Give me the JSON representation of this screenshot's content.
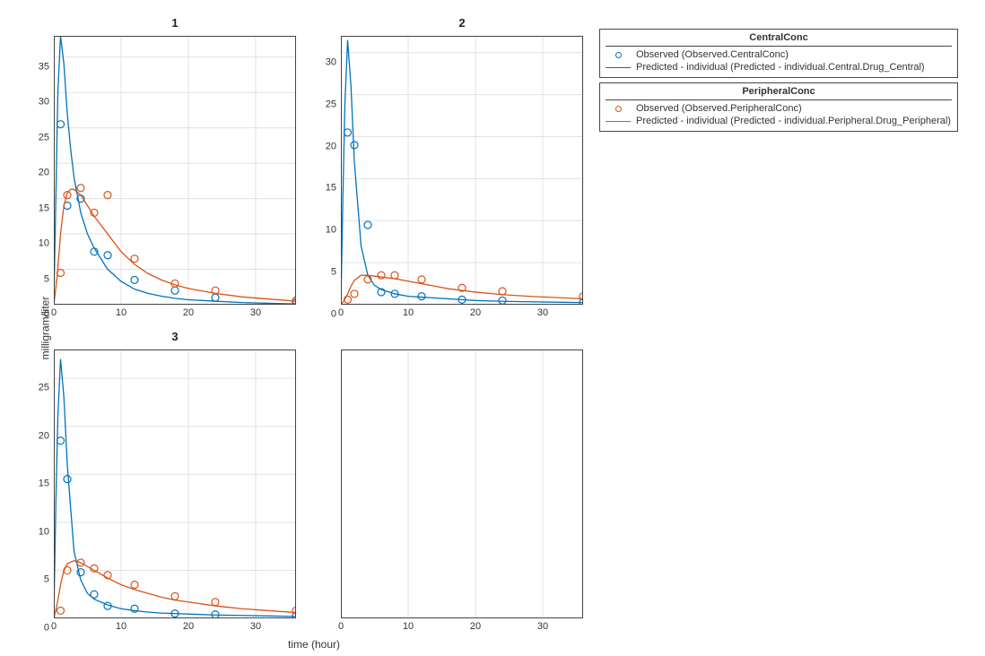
{
  "xlabel": "time (hour)",
  "ylabel": "milligram/liter",
  "colors": {
    "central": "#0072BD",
    "peripheral": "#D95319",
    "grid": "#e0e0e0",
    "axis": "#444"
  },
  "legends": {
    "central": {
      "title": "CentralConc",
      "items": [
        {
          "kind": "circle",
          "color": "central",
          "label": "Observed (Observed.CentralConc)"
        },
        {
          "kind": "line",
          "color": "central",
          "label": "Predicted - individual (Predicted - individual.Central.Drug_Central)"
        }
      ]
    },
    "peripheral": {
      "title": "PeripheralConc",
      "items": [
        {
          "kind": "circle",
          "color": "peripheral",
          "label": "Observed (Observed.PeripheralConc)"
        },
        {
          "kind": "line",
          "color": "peripheral",
          "label": "Predicted - individual (Predicted - individual.Peripheral.Drug_Peripheral)"
        }
      ]
    }
  },
  "chart_data": [
    {
      "id": "1",
      "title": "1",
      "xlim": [
        0,
        36
      ],
      "ylim": [
        0,
        38
      ],
      "xticks": [
        0,
        10,
        20,
        30
      ],
      "yticks": [
        0,
        5,
        10,
        15,
        20,
        25,
        30,
        35
      ],
      "series": [
        {
          "name": "Observed CentralConc",
          "kind": "points",
          "color": "central",
          "x": [
            1,
            2,
            4,
            6,
            8,
            12,
            18,
            24,
            36
          ],
          "y": [
            25.5,
            14.0,
            15.0,
            7.5,
            7.0,
            3.5,
            2.0,
            1.0,
            0.3
          ]
        },
        {
          "name": "Predicted CentralConc",
          "kind": "line",
          "color": "central",
          "x": [
            0,
            0.3,
            0.6,
            1,
            1.5,
            2,
            2.5,
            3,
            4,
            5,
            6,
            8,
            10,
            12,
            14,
            16,
            18,
            20,
            24,
            28,
            32,
            36
          ],
          "y": [
            0,
            15,
            30,
            38,
            34,
            27,
            22,
            18,
            13,
            10,
            8,
            5,
            3.3,
            2.2,
            1.6,
            1.2,
            0.9,
            0.7,
            0.5,
            0.3,
            0.2,
            0.1
          ]
        },
        {
          "name": "Observed PeripheralConc",
          "kind": "points",
          "color": "peripheral",
          "x": [
            1,
            2,
            4,
            6,
            8,
            12,
            18,
            24,
            36
          ],
          "y": [
            4.5,
            15.5,
            16.5,
            13.0,
            15.5,
            6.5,
            3.0,
            2.0,
            0.6
          ]
        },
        {
          "name": "Predicted PeripheralConc",
          "kind": "line",
          "color": "peripheral",
          "x": [
            0,
            0.5,
            1,
            1.5,
            2,
            2.5,
            3,
            4,
            5,
            6,
            8,
            10,
            12,
            14,
            16,
            18,
            20,
            24,
            28,
            32,
            36
          ],
          "y": [
            0,
            4,
            10,
            14,
            15.8,
            16.3,
            16.3,
            15.5,
            14,
            12.5,
            10,
            7.5,
            5.7,
            4.4,
            3.5,
            2.8,
            2.3,
            1.6,
            1.1,
            0.8,
            0.5
          ]
        }
      ]
    },
    {
      "id": "2",
      "title": "2",
      "xlim": [
        0,
        36
      ],
      "ylim": [
        0,
        32
      ],
      "xticks": [
        0,
        10,
        20,
        30
      ],
      "yticks": [
        0,
        5,
        10,
        15,
        20,
        25,
        30
      ],
      "series": [
        {
          "name": "Observed CentralConc",
          "kind": "points",
          "color": "central",
          "x": [
            1,
            2,
            4,
            6,
            8,
            12,
            18,
            24,
            36
          ],
          "y": [
            20.5,
            19.0,
            9.5,
            1.5,
            1.3,
            1.0,
            0.6,
            0.5,
            0.3
          ]
        },
        {
          "name": "Predicted CentralConc",
          "kind": "line",
          "color": "central",
          "x": [
            0,
            0.3,
            0.6,
            1,
            1.5,
            2,
            3,
            4,
            5,
            6,
            8,
            10,
            12,
            14,
            16,
            18,
            20,
            24,
            28,
            32,
            36
          ],
          "y": [
            0,
            13,
            24,
            31.5,
            26,
            17,
            7,
            3.5,
            2.3,
            1.8,
            1.3,
            1.0,
            0.9,
            0.8,
            0.7,
            0.6,
            0.5,
            0.4,
            0.35,
            0.3,
            0.25
          ]
        },
        {
          "name": "Observed PeripheralConc",
          "kind": "points",
          "color": "peripheral",
          "x": [
            1,
            2,
            4,
            6,
            8,
            12,
            18,
            24,
            36
          ],
          "y": [
            0.6,
            1.3,
            3.0,
            3.5,
            3.5,
            3.0,
            2.0,
            1.6,
            1.0
          ]
        },
        {
          "name": "Predicted PeripheralConc",
          "kind": "line",
          "color": "peripheral",
          "x": [
            0,
            0.5,
            1,
            1.5,
            2,
            3,
            4,
            6,
            8,
            10,
            12,
            14,
            16,
            18,
            20,
            24,
            28,
            32,
            36
          ],
          "y": [
            0,
            0.5,
            1.3,
            2.2,
            2.9,
            3.5,
            3.5,
            3.3,
            3.1,
            2.8,
            2.5,
            2.2,
            1.9,
            1.7,
            1.5,
            1.2,
            1.0,
            0.85,
            0.7
          ]
        }
      ]
    },
    {
      "id": "3",
      "title": "3",
      "xlim": [
        0,
        36
      ],
      "ylim": [
        0,
        28
      ],
      "xticks": [
        0,
        10,
        20,
        30
      ],
      "yticks": [
        0,
        5,
        10,
        15,
        20,
        25
      ],
      "series": [
        {
          "name": "Observed CentralConc",
          "kind": "points",
          "color": "central",
          "x": [
            1,
            2,
            4,
            6,
            8,
            12,
            18,
            24,
            36
          ],
          "y": [
            18.5,
            14.5,
            4.8,
            2.5,
            1.3,
            1.0,
            0.5,
            0.4,
            0.3
          ]
        },
        {
          "name": "Predicted CentralConc",
          "kind": "line",
          "color": "central",
          "x": [
            0,
            0.3,
            0.6,
            1,
            1.5,
            2,
            3,
            4,
            5,
            6,
            8,
            10,
            12,
            14,
            16,
            18,
            20,
            24,
            28,
            32,
            36
          ],
          "y": [
            0,
            12,
            21,
            27,
            23,
            16,
            7,
            4,
            2.6,
            2.0,
            1.4,
            1.0,
            0.8,
            0.65,
            0.55,
            0.5,
            0.45,
            0.35,
            0.3,
            0.25,
            0.2
          ]
        },
        {
          "name": "Observed PeripheralConc",
          "kind": "points",
          "color": "peripheral",
          "x": [
            1,
            2,
            4,
            6,
            8,
            12,
            18,
            24,
            36
          ],
          "y": [
            0.8,
            5.0,
            5.8,
            5.2,
            4.5,
            3.5,
            2.3,
            1.7,
            0.8
          ]
        },
        {
          "name": "Predicted PeripheralConc",
          "kind": "line",
          "color": "peripheral",
          "x": [
            0,
            0.5,
            1,
            1.5,
            2,
            3,
            4,
            5,
            6,
            8,
            10,
            12,
            14,
            16,
            18,
            20,
            24,
            28,
            32,
            36
          ],
          "y": [
            0,
            1.5,
            3.5,
            5.0,
            5.7,
            6.0,
            5.8,
            5.4,
            5.0,
            4.2,
            3.5,
            3.0,
            2.6,
            2.2,
            1.9,
            1.7,
            1.3,
            1.0,
            0.8,
            0.6
          ]
        }
      ]
    },
    {
      "id": "4",
      "title": "",
      "xlim": [
        0,
        36
      ],
      "ylim": [
        0,
        1
      ],
      "xticks": [
        0,
        10,
        20,
        30
      ],
      "yticks": [],
      "series": []
    }
  ]
}
